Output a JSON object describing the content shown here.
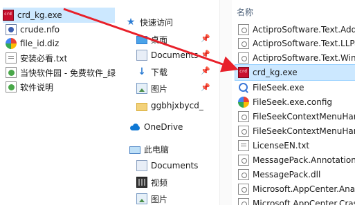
{
  "left_list": {
    "items": [
      {
        "label": "crd_kg.exe",
        "icon": "exe-app-icon"
      },
      {
        "label": "crude.nfo",
        "icon": "nfo-file-icon"
      },
      {
        "label": "file_id.diz",
        "icon": "diz-file-icon"
      },
      {
        "label": "安装必看.txt",
        "icon": "text-file-icon"
      },
      {
        "label": "当快软件园 - 免费软件_绿",
        "icon": "url-shortcut-icon"
      },
      {
        "label": "软件说明",
        "icon": "url-shortcut-icon"
      }
    ]
  },
  "nav_pane": {
    "quick_access": "快速访问",
    "items": [
      {
        "label": "桌面",
        "icon": "desktop-icon",
        "pinned": true
      },
      {
        "label": "Documents",
        "icon": "documents-icon",
        "pinned": true
      },
      {
        "label": "下载",
        "icon": "download-icon",
        "pinned": true
      },
      {
        "label": "图片",
        "icon": "pictures-icon",
        "pinned": true
      },
      {
        "label": "ggbhjxbycd_",
        "icon": "folder-icon",
        "pinned": false
      }
    ],
    "onedrive": "OneDrive",
    "this_pc": "此电脑",
    "pc_items": [
      {
        "label": "Documents",
        "icon": "documents-icon"
      },
      {
        "label": "视频",
        "icon": "video-icon"
      },
      {
        "label": "图片",
        "icon": "pictures-icon"
      }
    ]
  },
  "file_list": {
    "column_header": "名称",
    "items": [
      {
        "label": "ActiproSoftware.Text.Addo",
        "icon": "dll-file-icon"
      },
      {
        "label": "ActiproSoftware.Text.LLPa",
        "icon": "dll-file-icon"
      },
      {
        "label": "ActiproSoftware.Text.WinF",
        "icon": "dll-file-icon"
      },
      {
        "label": "crd_kg.exe",
        "icon": "exe-app-icon"
      },
      {
        "label": "FileSeek.exe",
        "icon": "search-icon"
      },
      {
        "label": "FileSeek.exe.config",
        "icon": "diz-file-icon"
      },
      {
        "label": "FileSeekContextMenuHand",
        "icon": "dll-file-icon"
      },
      {
        "label": "FileSeekContextMenuHand",
        "icon": "dll-file-icon"
      },
      {
        "label": "LicenseEN.txt",
        "icon": "text-file-icon"
      },
      {
        "label": "MessagePack.Annotations",
        "icon": "dll-file-icon"
      },
      {
        "label": "MessagePack.dll",
        "icon": "dll-file-icon"
      },
      {
        "label": "Microsoft.AppCenter.Anal",
        "icon": "dll-file-icon"
      },
      {
        "label": "Microsoft.AppCenter.Cras",
        "icon": "dll-file-icon"
      }
    ]
  },
  "colors": {
    "selection": "#cce8ff",
    "arrow": "#e8202a",
    "accent": "#2b7cd3"
  }
}
